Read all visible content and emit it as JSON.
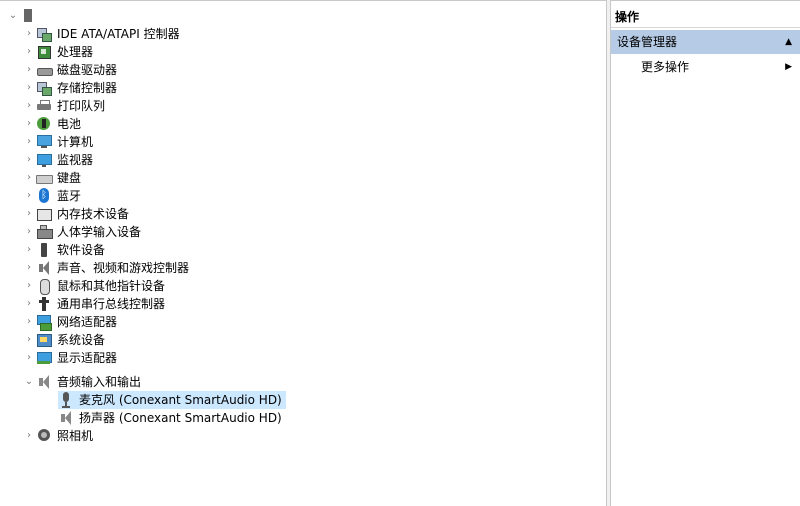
{
  "tree": {
    "items": [
      {
        "label": "IDE ATA/ATAPI 控制器",
        "icon": "ide-controller-icon"
      },
      {
        "label": "处理器",
        "icon": "processor-icon"
      },
      {
        "label": "磁盘驱动器",
        "icon": "disk-drive-icon"
      },
      {
        "label": "存储控制器",
        "icon": "storage-controller-icon"
      },
      {
        "label": "打印队列",
        "icon": "printer-icon"
      },
      {
        "label": "电池",
        "icon": "battery-icon"
      },
      {
        "label": "计算机",
        "icon": "computer-icon"
      },
      {
        "label": "监视器",
        "icon": "monitor-icon"
      },
      {
        "label": "键盘",
        "icon": "keyboard-icon"
      },
      {
        "label": "蓝牙",
        "icon": "bluetooth-icon"
      },
      {
        "label": "内存技术设备",
        "icon": "memory-device-icon"
      },
      {
        "label": "人体学输入设备",
        "icon": "hid-icon"
      },
      {
        "label": "软件设备",
        "icon": "software-device-icon"
      },
      {
        "label": "声音、视频和游戏控制器",
        "icon": "sound-controller-icon"
      },
      {
        "label": "鼠标和其他指针设备",
        "icon": "mouse-icon"
      },
      {
        "label": "通用串行总线控制器",
        "icon": "usb-icon"
      },
      {
        "label": "网络适配器",
        "icon": "network-adapter-icon"
      },
      {
        "label": "系统设备",
        "icon": "system-device-icon"
      },
      {
        "label": "显示适配器",
        "icon": "display-adapter-icon"
      },
      {
        "label": "音频输入和输出",
        "icon": "audio-io-icon",
        "expanded": true
      },
      {
        "label": "照相机",
        "icon": "camera-icon"
      }
    ],
    "audio_children": [
      {
        "label": "麦克风 (Conexant SmartAudio HD)",
        "icon": "microphone-icon",
        "selected": true
      },
      {
        "label": "扬声器 (Conexant SmartAudio HD)",
        "icon": "speaker-icon"
      }
    ],
    "chevron_collapsed": "›",
    "chevron_expanded": "⌄"
  },
  "actions": {
    "header": "操作",
    "section": "设备管理器",
    "section_arrow": "▲",
    "more": "更多操作",
    "more_arrow": "▶"
  },
  "colors": {
    "selection": "#cce8ff",
    "action_section_bg": "#b6cbe6"
  }
}
